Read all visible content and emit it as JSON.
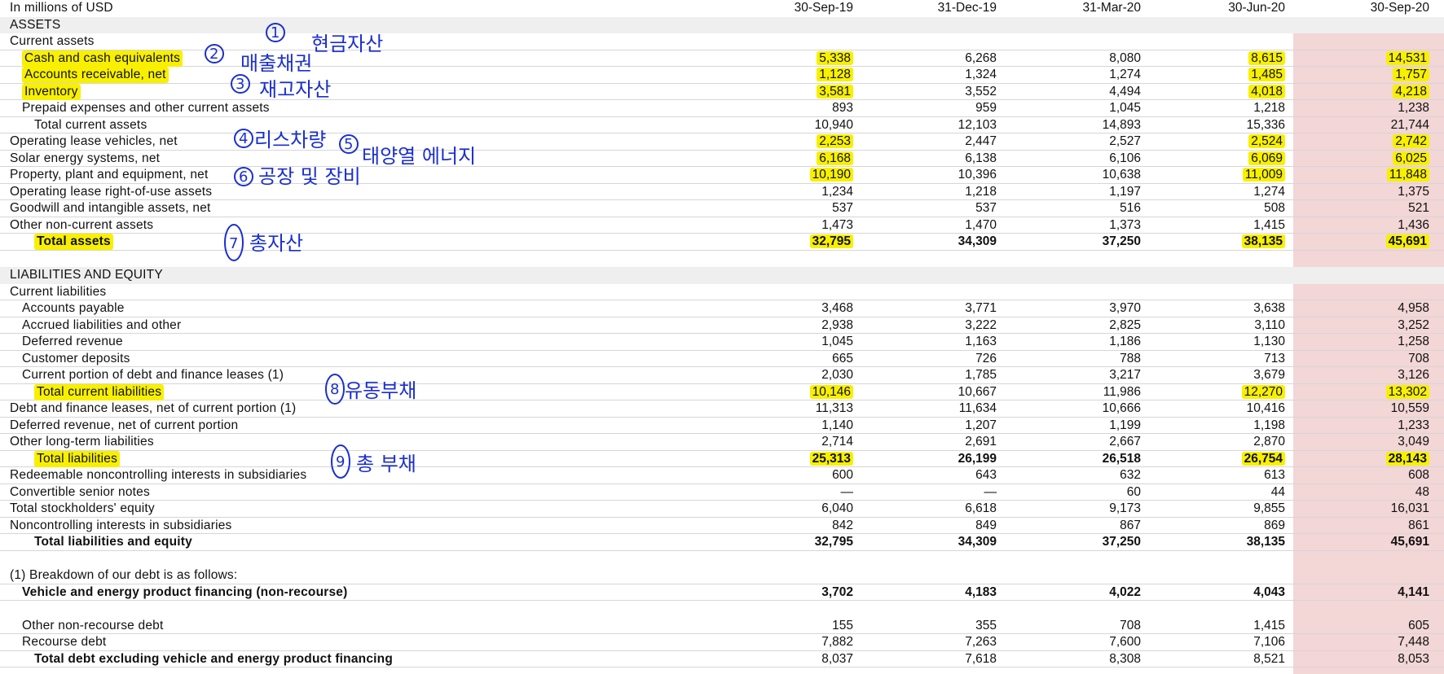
{
  "header": {
    "unit_label": "In millions of USD",
    "periods": [
      "30-Sep-19",
      "31-Dec-19",
      "31-Mar-20",
      "30-Jun-20",
      "30-Sep-20"
    ]
  },
  "rows": [
    {
      "label": "ASSETS",
      "indent": 0,
      "style": "band",
      "values": []
    },
    {
      "label": "Current assets",
      "indent": 0,
      "style": "plain",
      "values": []
    },
    {
      "label": "Cash and cash equivalents",
      "indent": 1,
      "style": "plain",
      "hl_label": true,
      "hl_cols": [
        0,
        3,
        4
      ],
      "values": [
        "5,338",
        "6,268",
        "8,080",
        "8,615",
        "14,531"
      ]
    },
    {
      "label": "Accounts receivable, net",
      "indent": 1,
      "style": "plain",
      "hl_label": true,
      "hl_cols": [
        0,
        3,
        4
      ],
      "values": [
        "1,128",
        "1,324",
        "1,274",
        "1,485",
        "1,757"
      ]
    },
    {
      "label": "Inventory",
      "indent": 1,
      "style": "plain",
      "hl_label": true,
      "hl_cols": [
        0,
        3,
        4
      ],
      "values": [
        "3,581",
        "3,552",
        "4,494",
        "4,018",
        "4,218"
      ]
    },
    {
      "label": "Prepaid expenses and other current assets",
      "indent": 1,
      "style": "plain",
      "values": [
        "893",
        "959",
        "1,045",
        "1,218",
        "1,238"
      ]
    },
    {
      "label": "Total current assets",
      "indent": 2,
      "style": "plain",
      "values": [
        "10,940",
        "12,103",
        "14,893",
        "15,336",
        "21,744"
      ]
    },
    {
      "label": "Operating lease vehicles, net",
      "indent": 0,
      "style": "plain",
      "hl_cols": [
        0,
        3,
        4
      ],
      "values": [
        "2,253",
        "2,447",
        "2,527",
        "2,524",
        "2,742"
      ]
    },
    {
      "label": "Solar energy systems, net",
      "indent": 0,
      "style": "plain",
      "hl_cols": [
        0,
        3,
        4
      ],
      "values": [
        "6,168",
        "6,138",
        "6,106",
        "6,069",
        "6,025"
      ]
    },
    {
      "label": "Property, plant and equipment, net",
      "indent": 0,
      "style": "plain",
      "hl_cols": [
        0,
        3,
        4
      ],
      "values": [
        "10,190",
        "10,396",
        "10,638",
        "11,009",
        "11,848"
      ]
    },
    {
      "label": "Operating lease right-of-use assets",
      "indent": 0,
      "style": "plain",
      "values": [
        "1,234",
        "1,218",
        "1,197",
        "1,274",
        "1,375"
      ]
    },
    {
      "label": "Goodwill and intangible assets, net",
      "indent": 0,
      "style": "plain",
      "values": [
        "537",
        "537",
        "516",
        "508",
        "521"
      ]
    },
    {
      "label": "Other non-current assets",
      "indent": 0,
      "style": "plain",
      "values": [
        "1,473",
        "1,470",
        "1,373",
        "1,415",
        "1,436"
      ]
    },
    {
      "label": "Total assets",
      "indent": 2,
      "style": "bold",
      "hl_label": true,
      "hl_cols": [
        0,
        3,
        4
      ],
      "values": [
        "32,795",
        "34,309",
        "37,250",
        "38,135",
        "45,691"
      ]
    },
    {
      "label": "",
      "indent": 0,
      "style": "blank",
      "values": []
    },
    {
      "label": "LIABILITIES AND EQUITY",
      "indent": 0,
      "style": "band",
      "values": []
    },
    {
      "label": "Current liabilities",
      "indent": 0,
      "style": "plain",
      "values": []
    },
    {
      "label": "Accounts payable",
      "indent": 1,
      "style": "plain",
      "values": [
        "3,468",
        "3,771",
        "3,970",
        "3,638",
        "4,958"
      ]
    },
    {
      "label": "Accrued liabilities and other",
      "indent": 1,
      "style": "plain",
      "values": [
        "2,938",
        "3,222",
        "2,825",
        "3,110",
        "3,252"
      ]
    },
    {
      "label": "Deferred revenue",
      "indent": 1,
      "style": "plain",
      "values": [
        "1,045",
        "1,163",
        "1,186",
        "1,130",
        "1,258"
      ]
    },
    {
      "label": "Customer deposits",
      "indent": 1,
      "style": "plain",
      "values": [
        "665",
        "726",
        "788",
        "713",
        "708"
      ]
    },
    {
      "label": "Current portion of debt and finance leases (1)",
      "indent": 1,
      "style": "plain",
      "values": [
        "2,030",
        "1,785",
        "3,217",
        "3,679",
        "3,126"
      ]
    },
    {
      "label": "Total current liabilities",
      "indent": 2,
      "style": "plain",
      "hl_label": true,
      "hl_cols": [
        0,
        3,
        4
      ],
      "values": [
        "10,146",
        "10,667",
        "11,986",
        "12,270",
        "13,302"
      ]
    },
    {
      "label": "Debt and finance leases, net of current portion (1)",
      "indent": 0,
      "style": "plain",
      "values": [
        "11,313",
        "11,634",
        "10,666",
        "10,416",
        "10,559"
      ]
    },
    {
      "label": "Deferred revenue, net of current portion",
      "indent": 0,
      "style": "plain",
      "values": [
        "1,140",
        "1,207",
        "1,199",
        "1,198",
        "1,233"
      ]
    },
    {
      "label": "Other long-term liabilities",
      "indent": 0,
      "style": "plain",
      "values": [
        "2,714",
        "2,691",
        "2,667",
        "2,870",
        "3,049"
      ]
    },
    {
      "label": "Total liabilities",
      "indent": 2,
      "style": "bold-values",
      "hl_label": true,
      "hl_cols": [
        0,
        3,
        4
      ],
      "values": [
        "25,313",
        "26,199",
        "26,518",
        "26,754",
        "28,143"
      ]
    },
    {
      "label": "Redeemable noncontrolling interests in subsidiaries",
      "indent": 0,
      "style": "plain",
      "values": [
        "600",
        "643",
        "632",
        "613",
        "608"
      ]
    },
    {
      "label": "Convertible senior notes",
      "indent": 0,
      "style": "plain",
      "values": [
        "—",
        "—",
        "60",
        "44",
        "48"
      ]
    },
    {
      "label": "Total stockholders' equity",
      "indent": 0,
      "style": "plain",
      "values": [
        "6,040",
        "6,618",
        "9,173",
        "9,855",
        "16,031"
      ]
    },
    {
      "label": "Noncontrolling interests in subsidiaries",
      "indent": 0,
      "style": "plain",
      "values": [
        "842",
        "849",
        "867",
        "869",
        "861"
      ]
    },
    {
      "label": "Total liabilities and equity",
      "indent": 2,
      "style": "bold",
      "values": [
        "32,795",
        "34,309",
        "37,250",
        "38,135",
        "45,691"
      ]
    },
    {
      "label": "",
      "indent": 0,
      "style": "blank",
      "values": []
    },
    {
      "label": "(1) Breakdown of our debt is as follows:",
      "indent": 0,
      "style": "plain",
      "values": []
    },
    {
      "label": "Vehicle and energy product financing (non-recourse)",
      "indent": 1,
      "style": "bold",
      "values": [
        "3,702",
        "4,183",
        "4,022",
        "4,043",
        "4,141"
      ]
    },
    {
      "label": "",
      "indent": 0,
      "style": "blank",
      "values": []
    },
    {
      "label": "Other non-recourse debt",
      "indent": 1,
      "style": "plain",
      "values": [
        "155",
        "355",
        "708",
        "1,415",
        "605"
      ]
    },
    {
      "label": "Recourse debt",
      "indent": 1,
      "style": "plain",
      "values": [
        "7,882",
        "7,263",
        "7,600",
        "7,106",
        "7,448"
      ]
    },
    {
      "label": "Total debt excluding vehicle and energy product financing",
      "indent": 2,
      "style": "bold-label",
      "values": [
        "8,037",
        "7,618",
        "8,308",
        "8,521",
        "8,053"
      ]
    }
  ],
  "annotations": {
    "color": "#1a2fd0",
    "notes": [
      {
        "num": "1",
        "text": "현금자산"
      },
      {
        "num": "2",
        "text": "매출채권"
      },
      {
        "num": "3",
        "text": "재고자산"
      },
      {
        "num": "4",
        "text": "리스차량"
      },
      {
        "num": "5",
        "text": "태양열 에너지"
      },
      {
        "num": "6",
        "text": "공장 및 장비"
      },
      {
        "num": "7",
        "text": "총자산"
      },
      {
        "num": "8",
        "text": "유동부채"
      },
      {
        "num": "9",
        "text": "총 부채"
      }
    ]
  },
  "colors": {
    "highlight": "#f8f000",
    "last_column_shade": "#f3d6d6",
    "section_band": "#efefef"
  }
}
